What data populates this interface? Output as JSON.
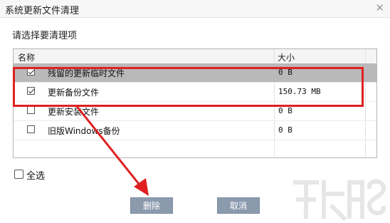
{
  "window": {
    "title": "系统更新文件清理"
  },
  "instruction": "请选择要清理项",
  "table": {
    "columns": [
      "名称",
      "大小"
    ],
    "rows": [
      {
        "name": "残留的更新临时文件",
        "size": "0 B",
        "checked": true
      },
      {
        "name": "更新备份文件",
        "size": "150.73 MB",
        "checked": true
      },
      {
        "name": "更新安装文件",
        "size": "0 B",
        "checked": false
      },
      {
        "name": "旧版Windows备份",
        "size": "0 B",
        "checked": false
      }
    ]
  },
  "select_all": {
    "label": "全选",
    "checked": false
  },
  "buttons": {
    "delete": "删除",
    "cancel": "取消"
  },
  "colors": {
    "annotation_red": "#e02020",
    "button_bg": "#8c9aae",
    "selected_row": "#b9b9b9"
  }
}
